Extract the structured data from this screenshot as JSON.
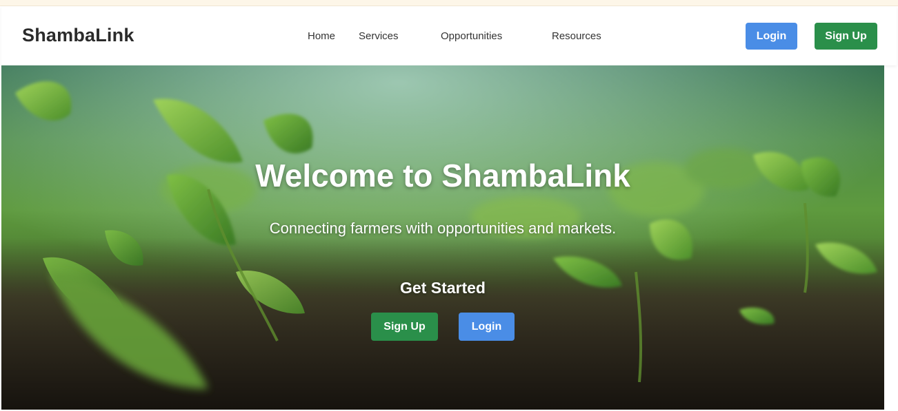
{
  "header": {
    "brand": "ShambaLink",
    "nav": {
      "home": "Home",
      "services": "Services",
      "opportunities": "Opportunities",
      "resources": "Resources"
    },
    "login_label": "Login",
    "signup_label": "Sign Up"
  },
  "hero": {
    "title": "Welcome to ShambaLink",
    "subtitle": "Connecting farmers with opportunities and markets.",
    "cta_heading": "Get Started",
    "signup_label": "Sign Up",
    "login_label": "Login",
    "background": "seedlings-in-soil-photo"
  },
  "colors": {
    "primary_blue": "#4a8de6",
    "primary_green": "#2a8f4a",
    "brand_text": "#2b2b2b"
  }
}
